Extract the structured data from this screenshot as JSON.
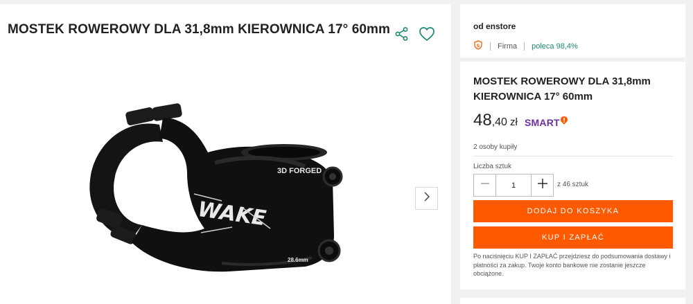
{
  "product": {
    "title": "MOSTEK ROWEROWY DLA 31,8mm KIEROWNICA 17° 60mm"
  },
  "icons": {
    "share": "share-icon",
    "favorite": "heart-icon",
    "next": "chevron-right-icon",
    "seller_badge": "super-seller-icon"
  },
  "seller": {
    "name": "od enstore",
    "type": "Firma",
    "rating": "poleca 98,4%"
  },
  "offer": {
    "title": "MOSTEK ROWEROWY DLA 31,8mm KIEROWNICA 17° 60mm",
    "price_int": "48",
    "price_dec": ",40",
    "currency": "zł",
    "smart_label": "SMART",
    "bought": "2 osoby kupiły",
    "qty_label": "Liczba sztuk",
    "qty_value": "1",
    "qty_available": "z 46 sztuk",
    "add_to_cart": "DODAJ DO KOSZYKA",
    "buy_now": "KUP I ZAPŁAĆ",
    "note": "Po naciśnięciu KUP I ZAPŁAĆ przejdziesz do podsumowania dostawy i płatności za zakup. Twoje konto bankowe nie zostanie jeszcze obciążone."
  },
  "image_text": {
    "brand": "WAKE",
    "forged": "3D FORGED",
    "size": "28.6mm"
  },
  "colors": {
    "accent": "#ff5a00",
    "rating": "#1a8a72",
    "icon": "#1a8a72",
    "smart": "#6b2fa8"
  }
}
